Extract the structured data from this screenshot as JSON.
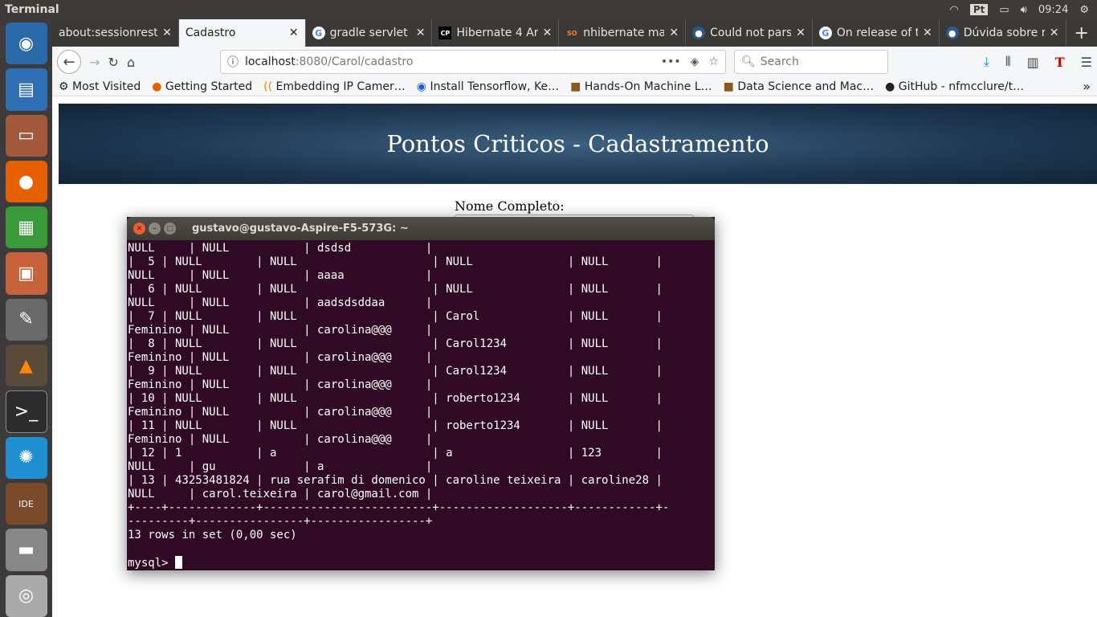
{
  "topbar": {
    "app": "Terminal",
    "lang": "Pt",
    "time": "09:24"
  },
  "tabs": [
    {
      "label": "about:sessionrest",
      "icon": ""
    },
    {
      "label": "Cadastro",
      "icon": ""
    },
    {
      "label": "gradle servlet",
      "icon": "G"
    },
    {
      "label": "Hibernate 4 Ar",
      "icon": "CP"
    },
    {
      "label": "nhibernate ma",
      "icon": "SO"
    },
    {
      "label": "Could not pars",
      "icon": "●"
    },
    {
      "label": "On release of t",
      "icon": "G"
    },
    {
      "label": "Dúvida sobre r",
      "icon": "●"
    }
  ],
  "nav": {
    "url_host": "localhost",
    "url_path": ":8080/Carol/cadastro",
    "search_placeholder": "Search"
  },
  "bookmarks": [
    "Most Visited",
    "Getting Started",
    "Embedding IP Camer…",
    "Install Tensorflow, Ke…",
    "Hands-On Machine L…",
    "Data Science and Mac…",
    "GitHub - nfmcclure/t…"
  ],
  "page": {
    "title": "Pontos Criticos - Cadastramento",
    "field_label": "Nome Completo:"
  },
  "terminal": {
    "title": "gustavo@gustavo-Aspire-F5-573G: ~",
    "lines": [
      "NULL     | NULL           | dsdsd           |",
      "|  5 | NULL        | NULL                    | NULL              | NULL       |",
      "NULL     | NULL           | aaaa            |",
      "|  6 | NULL        | NULL                    | NULL              | NULL       |",
      "NULL     | NULL           | aadsdsddaa      |",
      "|  7 | NULL        | NULL                    | Carol             | NULL       |",
      "Feminino | NULL           | carolina@@@     |",
      "|  8 | NULL        | NULL                    | Carol1234         | NULL       |",
      "Feminino | NULL           | carolina@@@     |",
      "|  9 | NULL        | NULL                    | Carol1234         | NULL       |",
      "Feminino | NULL           | carolina@@@     |",
      "| 10 | NULL        | NULL                    | roberto1234       | NULL       |",
      "Feminino | NULL           | carolina@@@     |",
      "| 11 | NULL        | NULL                    | roberto1234       | NULL       |",
      "Feminino | NULL           | carolina@@@     |",
      "| 12 | 1           | a                       | a                 | 123        |",
      "NULL     | gu             | a               |",
      "| 13 | 43253481824 | rua serafim di domenico | caroline teixeira | caroline28 |",
      "NULL     | carol.teixeira | carol@gmail.com |",
      "+----+-------------+-------------------------+-------------------+------------+-",
      "---------+----------------+-----------------+",
      "13 rows in set (0,00 sec)",
      ""
    ],
    "prompt": "mysql> "
  }
}
